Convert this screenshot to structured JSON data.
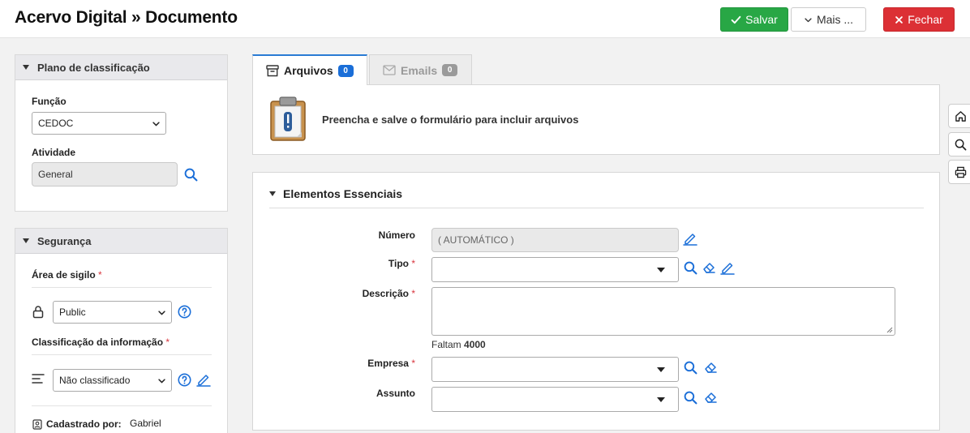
{
  "header": {
    "title": "Acervo Digital » Documento",
    "save_label": "Salvar",
    "more_label": "Mais ...",
    "close_label": "Fechar"
  },
  "classification_panel": {
    "title": "Plano de classificação",
    "funcao_label": "Função",
    "funcao_value": "CEDOC",
    "atividade_label": "Atividade",
    "atividade_value": "General"
  },
  "security_panel": {
    "title": "Segurança",
    "sigilo_label": "Área de sigilo",
    "sigilo_value": "Public",
    "classificacao_label": "Classificação da informação",
    "classificacao_value": "Não classificado",
    "cadastrado_label": "Cadastrado por:",
    "cadastrado_value": "Gabriel",
    "required_mark": "*"
  },
  "tabs": [
    {
      "label": "Arquivos",
      "count": "0"
    },
    {
      "label": "Emails",
      "count": "0"
    }
  ],
  "files": {
    "message": "Preencha e salve o formulário para incluir arquivos"
  },
  "essentials": {
    "title": "Elementos Essenciais",
    "numero_label": "Número",
    "numero_value": "( AUTOMÁTICO )",
    "tipo_label": "Tipo",
    "descricao_label": "Descrição",
    "counter_prefix": "Faltam",
    "counter_value": "4000",
    "empresa_label": "Empresa",
    "assunto_label": "Assunto",
    "required_mark": "*"
  },
  "colors": {
    "save": "#28a745",
    "close": "#dc3035",
    "accent": "#1a6ed8"
  }
}
